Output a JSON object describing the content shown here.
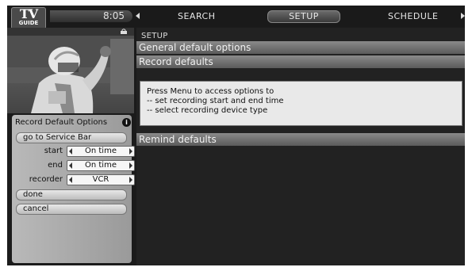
{
  "app": {
    "logo_top": "TV",
    "logo_bottom": "GUIDE",
    "clock": "8:05"
  },
  "nav": {
    "tabs": [
      {
        "label": "SEARCH"
      },
      {
        "label": "SETUP",
        "selected": true
      },
      {
        "label": "SCHEDULE"
      }
    ]
  },
  "menu": {
    "title": "Record Default Options",
    "go_service_bar": "go to Service Bar",
    "start_label": "start",
    "start_value": "On time",
    "end_label": "end",
    "end_value": "On time",
    "recorder_label": "recorder",
    "recorder_value": "VCR",
    "done": "done",
    "cancel": "cancel"
  },
  "main": {
    "breadcrumb": "SETUP",
    "sections": [
      {
        "label": "General default options"
      },
      {
        "label": "Record defaults",
        "selected": true
      },
      {
        "label": "Remind defaults"
      }
    ],
    "info_lines": [
      "Press Menu to access options to",
      "-- set recording start and end time",
      "-- select recording device type"
    ]
  },
  "colors": {
    "background": "#1b1b1b",
    "panel_gray": "#b0b0b0",
    "header_gray": "#6e6e6e",
    "selected_header": "#c0c0c0"
  }
}
